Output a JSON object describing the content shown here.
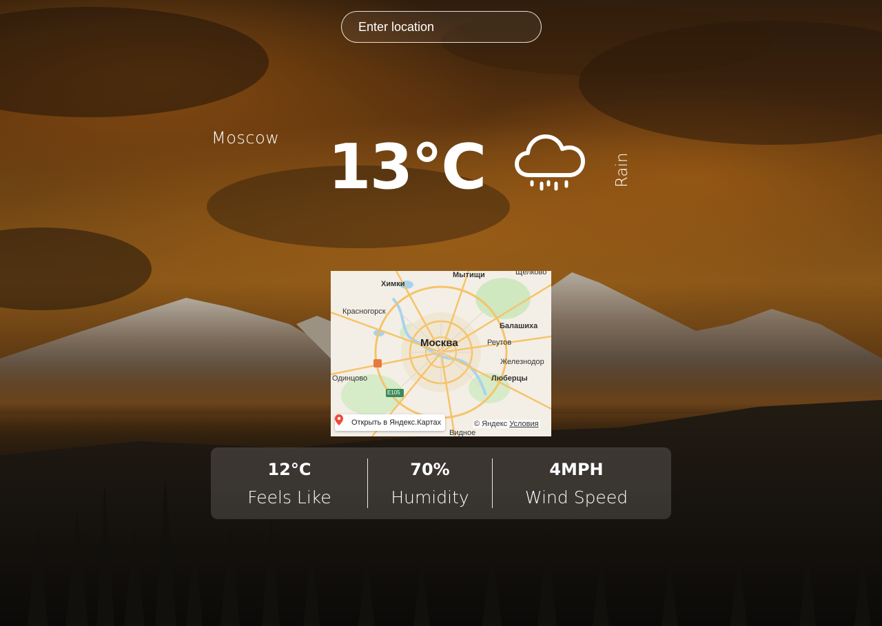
{
  "search": {
    "placeholder": "Enter location"
  },
  "weather": {
    "city": "Moscow",
    "temperature": "13°C",
    "condition": "Rain",
    "icon": "cloud-rain-icon"
  },
  "map": {
    "labels": {
      "mytishchi": "Мытищи",
      "shchelkovo": "Щелково",
      "khimki": "Химки",
      "krasnogorsk": "Красногорск",
      "balashikha": "Балашиха",
      "moskva": "Москва",
      "reutov": "Реутов",
      "zheleznodor": "Железнодор",
      "odintsovo": "Одинцово",
      "lyubertsy": "Люберцы",
      "e105": "E105",
      "vidnoe": "Видное"
    },
    "open_button": "Открыть в Яндекс.Картах",
    "copyright": "© Яндекс",
    "terms": "Условия"
  },
  "stats": [
    {
      "value": "12°C",
      "label": "Feels Like"
    },
    {
      "value": "70%",
      "label": "Humidity"
    },
    {
      "value": "4MPH",
      "label": "Wind Speed"
    }
  ],
  "colors": {
    "text": "#ffffff",
    "sky_orange": "#a86a1e",
    "map_land": "#f3efe6",
    "map_road": "#f6c36a",
    "map_water": "#a7d3ee"
  }
}
